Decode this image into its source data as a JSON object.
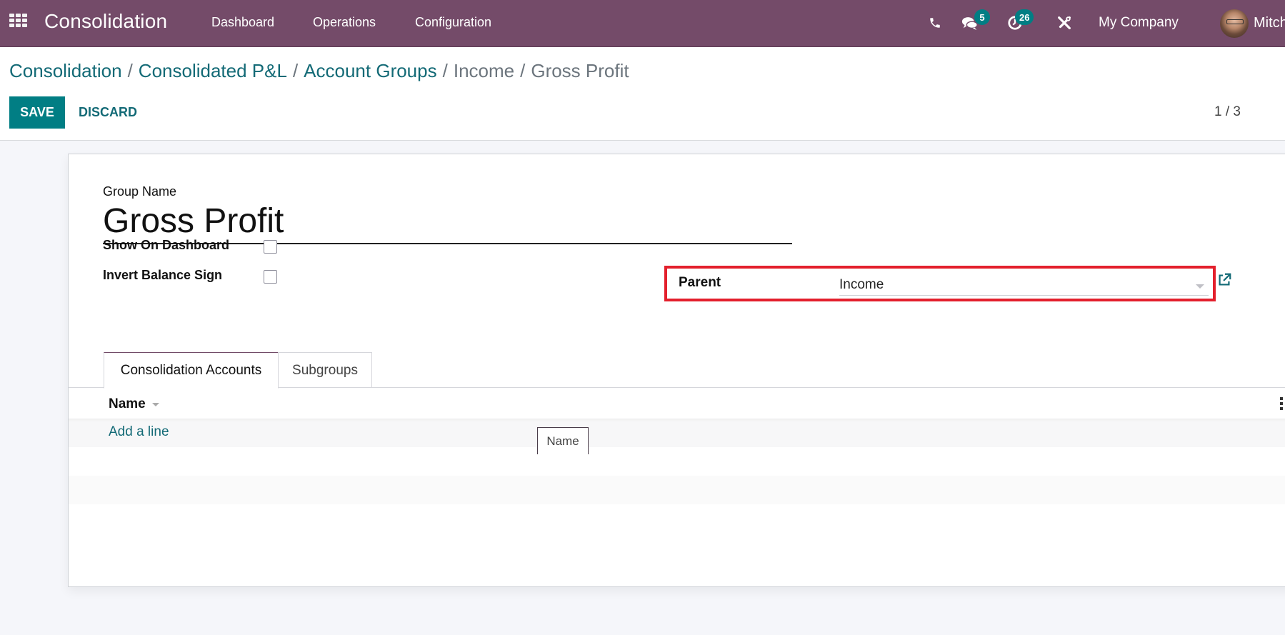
{
  "navbar": {
    "app_name": "Consolidation",
    "menu": [
      "Dashboard",
      "Operations",
      "Configuration"
    ],
    "icons": {
      "apps": "apps-grid-icon",
      "phone": "phone-icon",
      "messages": "chat-icon",
      "activities": "clock-icon",
      "debug": "tools-icon"
    },
    "messages_count": "5",
    "activities_count": "26",
    "company": "My Company",
    "user": "Mitch"
  },
  "breadcrumb": {
    "links": [
      "Consolidation",
      "Consolidated P&L",
      "Account Groups"
    ],
    "inactive": [
      "Income"
    ],
    "current": "Gross Profit",
    "separator": "/"
  },
  "toolbar": {
    "save_label": "SAVE",
    "discard_label": "DISCARD",
    "pager": "1 / 3"
  },
  "form": {
    "group_name_label": "Group Name",
    "group_name_value": "Gross Profit",
    "show_on_dashboard_label": "Show On Dashboard",
    "show_on_dashboard_checked": false,
    "invert_balance_sign_label": "Invert Balance Sign",
    "invert_balance_sign_checked": false,
    "parent_label": "Parent",
    "parent_value": "Income",
    "highlight_color": "#e3202c"
  },
  "tabs": [
    {
      "label": "Consolidation Accounts",
      "active": true
    },
    {
      "label": "Subgroups",
      "active": false
    }
  ],
  "list": {
    "columns": [
      "Name"
    ],
    "add_line_label": "Add a line",
    "rows": []
  },
  "tooltip": {
    "text": "Name"
  },
  "colors": {
    "navbar": "#744b69",
    "primary": "#017e84",
    "link": "#136a76"
  }
}
